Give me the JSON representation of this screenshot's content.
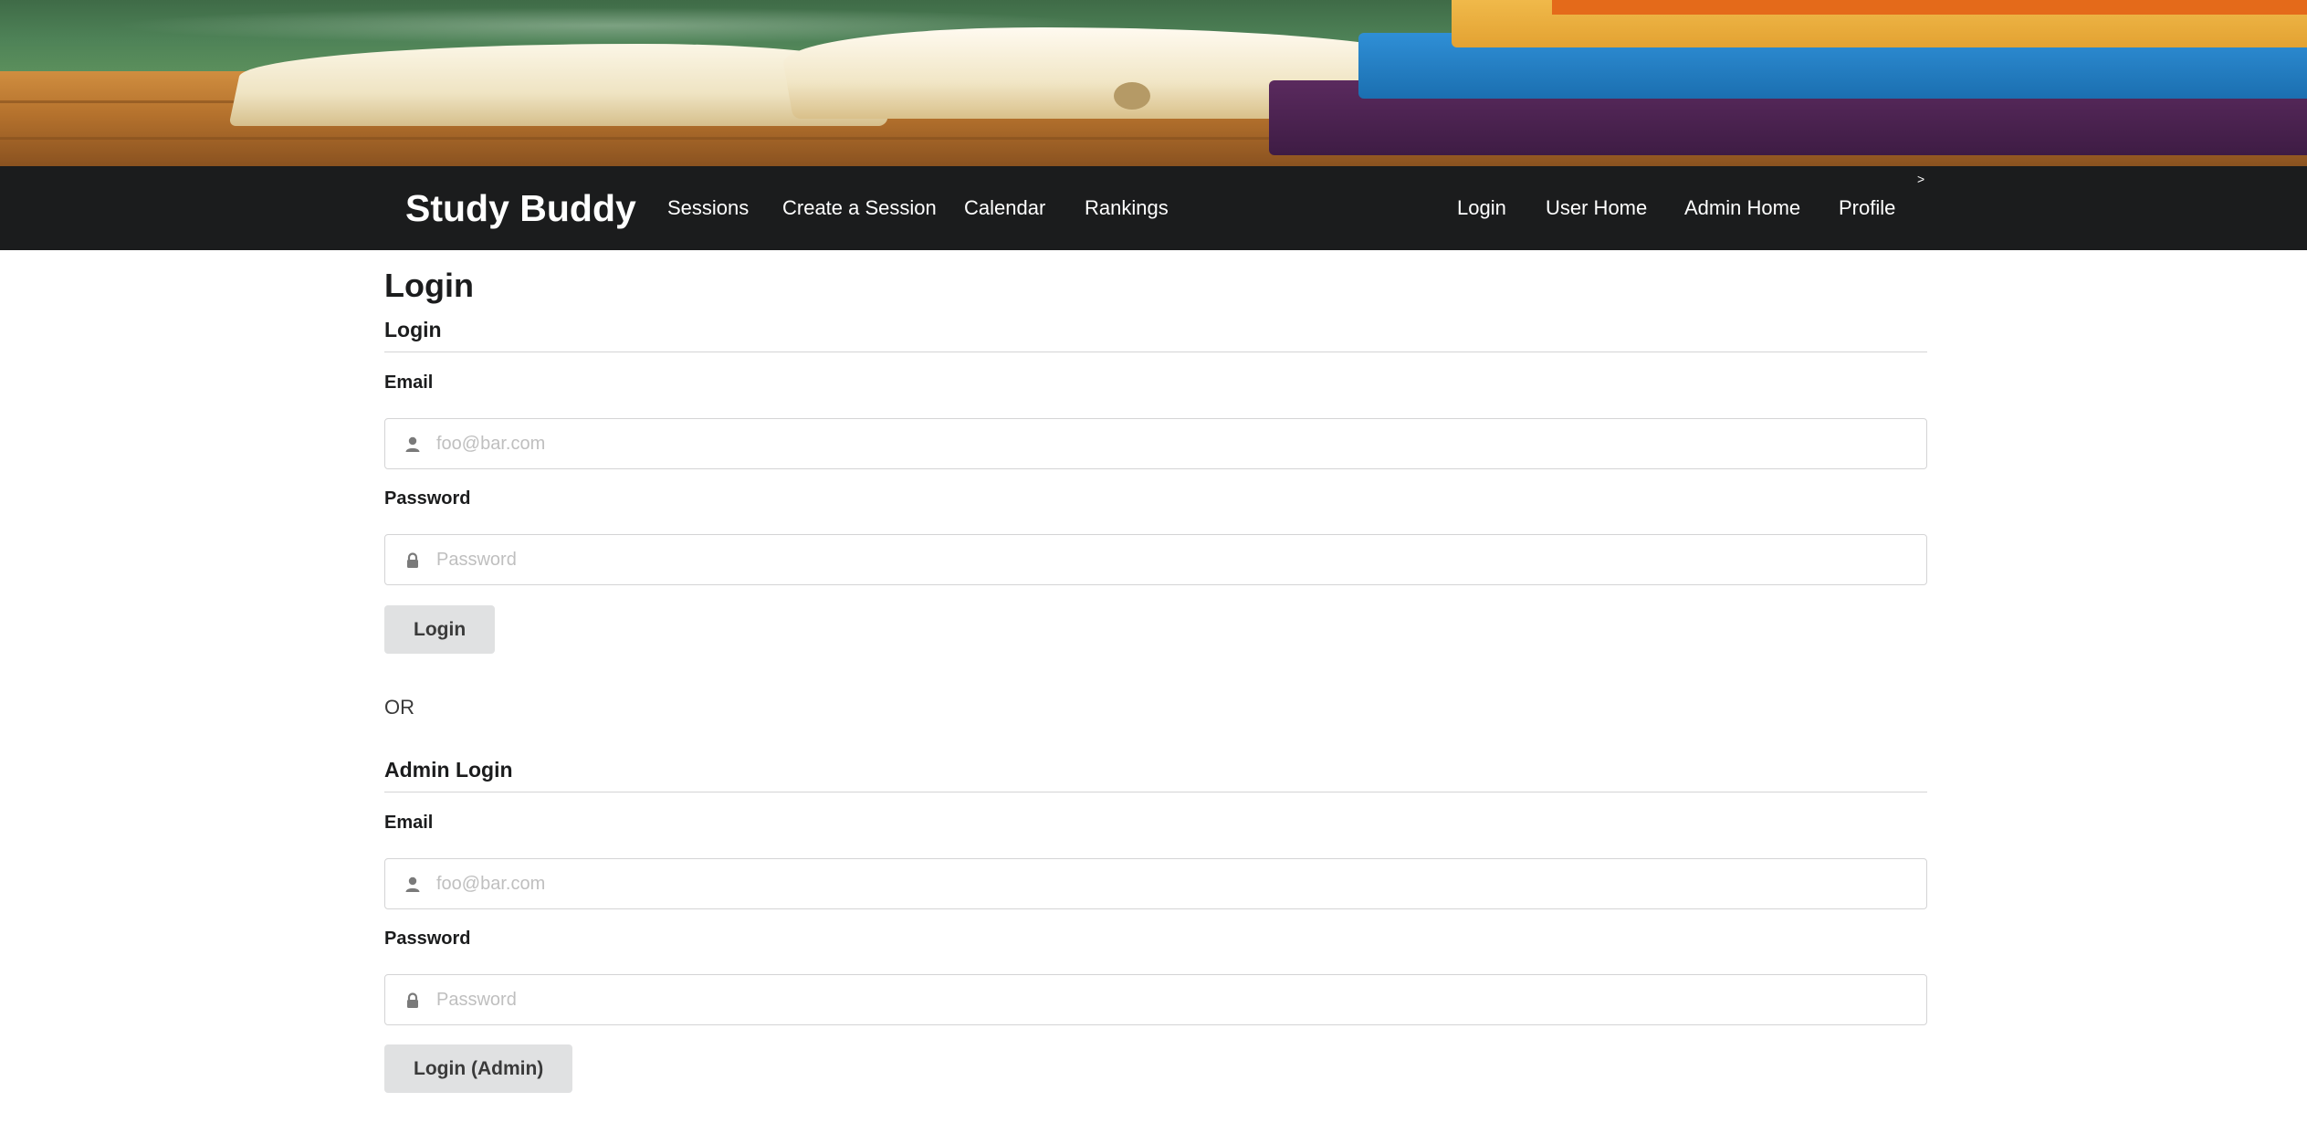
{
  "navbar": {
    "brand": "Study Buddy",
    "left_items": [
      "Sessions",
      "Create a Session",
      "Calendar",
      "Rankings"
    ],
    "right_items": [
      "Login",
      "User Home",
      "Admin Home",
      "Profile"
    ],
    "caret": ">"
  },
  "page": {
    "title": "Login"
  },
  "login_form": {
    "header": "Login",
    "email_label": "Email",
    "email_placeholder": "foo@bar.com",
    "password_label": "Password",
    "password_placeholder": "Password",
    "submit_label": "Login"
  },
  "separator": "OR",
  "admin_form": {
    "header": "Admin Login",
    "email_label": "Email",
    "email_placeholder": "foo@bar.com",
    "password_label": "Password",
    "password_placeholder": "Password",
    "submit_label": "Login (Admin)"
  },
  "icons": {
    "email": "user-icon",
    "password": "lock-icon"
  },
  "colors": {
    "navbar_bg": "#1b1c1d",
    "button_bg": "#e0e1e2",
    "border": "#d4d4d5",
    "icon": "#7a7a7a"
  }
}
